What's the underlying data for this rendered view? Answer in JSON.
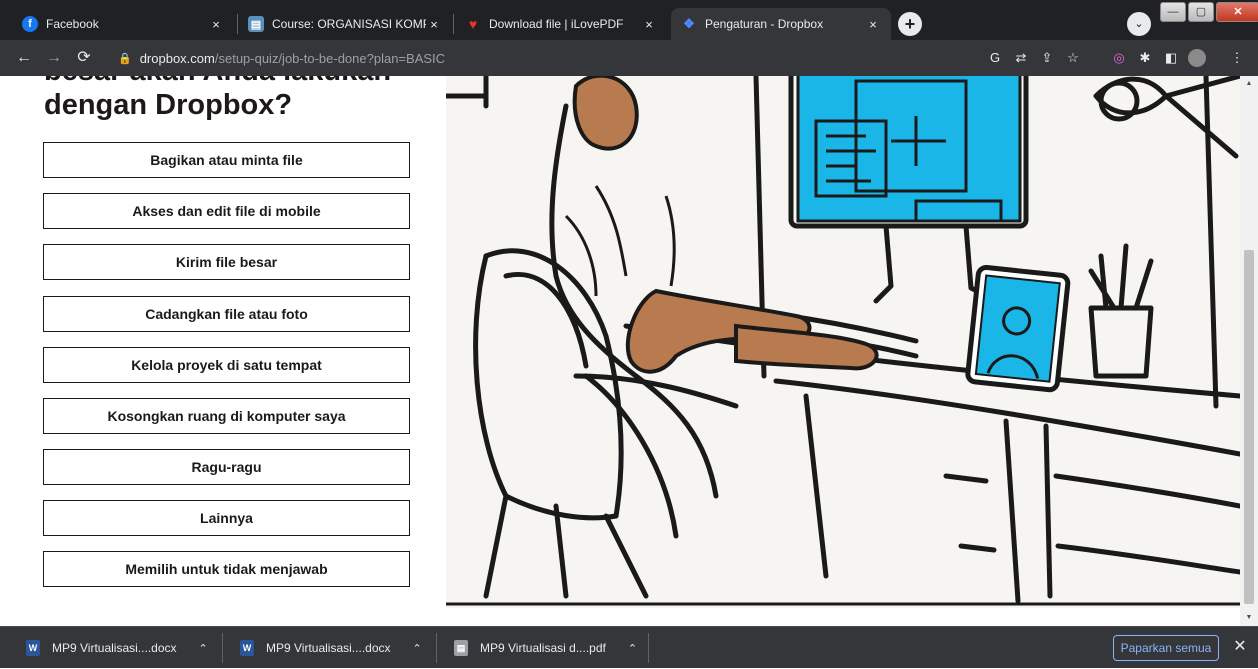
{
  "browser": {
    "tabs": [
      {
        "title": "Facebook",
        "favicon": "facebook-icon",
        "color": "#1877f2",
        "glyph": "f",
        "close": "×"
      },
      {
        "title": "Course: ORGANISASI KOMPUTER",
        "favicon": "course-icon",
        "color": "#5a8fbe",
        "glyph": "▤",
        "close": "×"
      },
      {
        "title": "Download file | iLovePDF",
        "favicon": "heart-icon",
        "color": "#e5322d",
        "glyph": "♥",
        "close": "×"
      },
      {
        "title": "Pengaturan - Dropbox",
        "favicon": "dropbox-icon",
        "color": "#0061fe",
        "glyph": "❖",
        "close": "×"
      }
    ],
    "url_host": "dropbox.com",
    "url_path": "/setup-quiz/job-to-be-done?plan=BASIC"
  },
  "page": {
    "heading_line1": "besar akan Anda lakukan",
    "heading_line2": "dengan Dropbox?",
    "options": [
      "Bagikan atau minta file",
      "Akses dan edit file di mobile",
      "Kirim file besar",
      "Cadangkan file atau foto",
      "Kelola proyek di satu tempat",
      "Kosongkan ruang di komputer saya",
      "Ragu-ragu",
      "Lainnya",
      "Memilih untuk tidak menjawab"
    ],
    "accent_color": "#1bb6e8"
  },
  "downloads": {
    "items": [
      {
        "name": "MP9 Virtualisasi....docx",
        "icon": "word-icon"
      },
      {
        "name": "MP9 Virtualisasi....docx",
        "icon": "word-icon"
      },
      {
        "name": "MP9 Virtualisasi d....pdf",
        "icon": "pdf-icon"
      }
    ],
    "show_all": "Paparkan semua"
  }
}
